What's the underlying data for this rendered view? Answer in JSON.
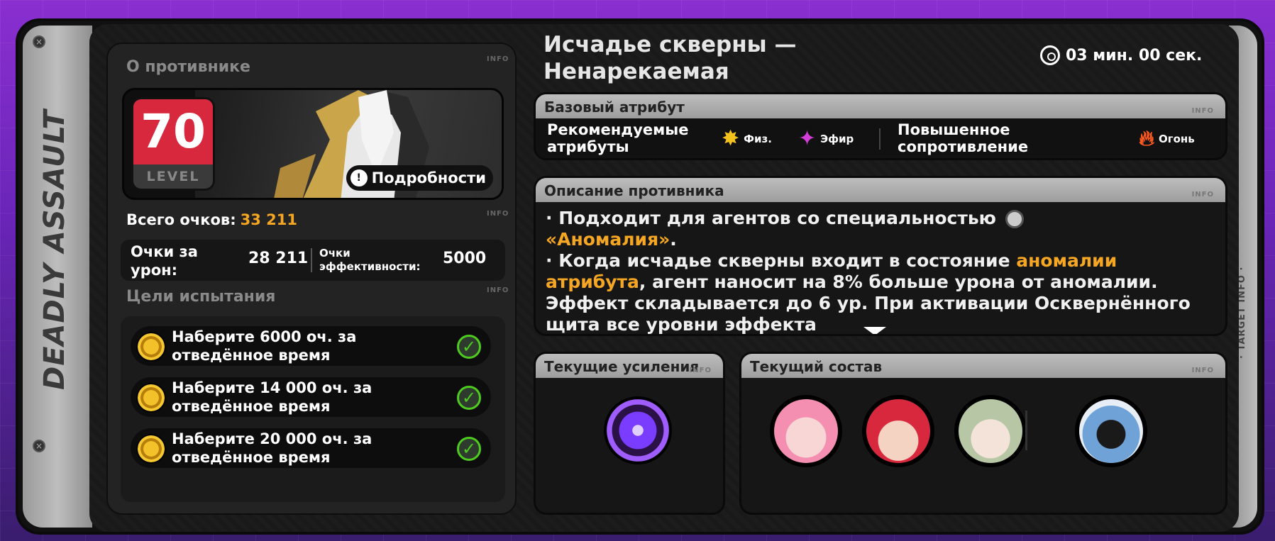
{
  "side_title": "DEADLY ASSAULT",
  "side_right_label": "· TARGET INFO ·",
  "info_tag": "INFO",
  "about_enemy": {
    "title": "О противнике",
    "level_number": "70",
    "level_label": "LEVEL",
    "details_button": "Подробности"
  },
  "totals": {
    "label": "Всего очков:",
    "value": "33 211",
    "damage_label": "Очки за урон:",
    "damage_value": "28 211",
    "efficiency_label": "Очки эффективности:",
    "efficiency_value": "5000"
  },
  "goals": {
    "title": "Цели испытания",
    "items": [
      {
        "text": "Наберите 6000 оч. за отведённое время",
        "done": true
      },
      {
        "text": "Наберите 14 000 оч. за отведённое время",
        "done": true
      },
      {
        "text": "Наберите 20 000 оч. за отведённое время",
        "done": true
      }
    ]
  },
  "enemy": {
    "name": "Исчадье скверны — Ненарекаемая",
    "timer": "03 мин. 00 сек."
  },
  "base_attr": {
    "title": "Базовый атрибут",
    "recommended_label": "Рекомендуемые атрибуты",
    "attr1": "Физ.",
    "attr2": "Эфир",
    "resist_label": "Повышенное сопротивление",
    "resist_attr": "Огонь"
  },
  "description": {
    "title": "Описание противника",
    "line1_a": "· Подходит для агентов со специальностью",
    "line1_hl": "«Аномалия»",
    "line1_end": ".",
    "line2_a": "· Когда исчадье скверны входит в состояние",
    "line2_hl": "аномалии атрибута",
    "line2_b": ", агент наносит на 8% больше урона от аномалии. Эффект складывается до 6 ур. При активации Осквернённого щита все уровни эффекта"
  },
  "buffs": {
    "title": "Текущие усиления"
  },
  "team": {
    "title": "Текущий состав"
  },
  "colors": {
    "accent": "#f5a623",
    "level_red": "#d8283e",
    "check_green": "#4ecb1f"
  }
}
